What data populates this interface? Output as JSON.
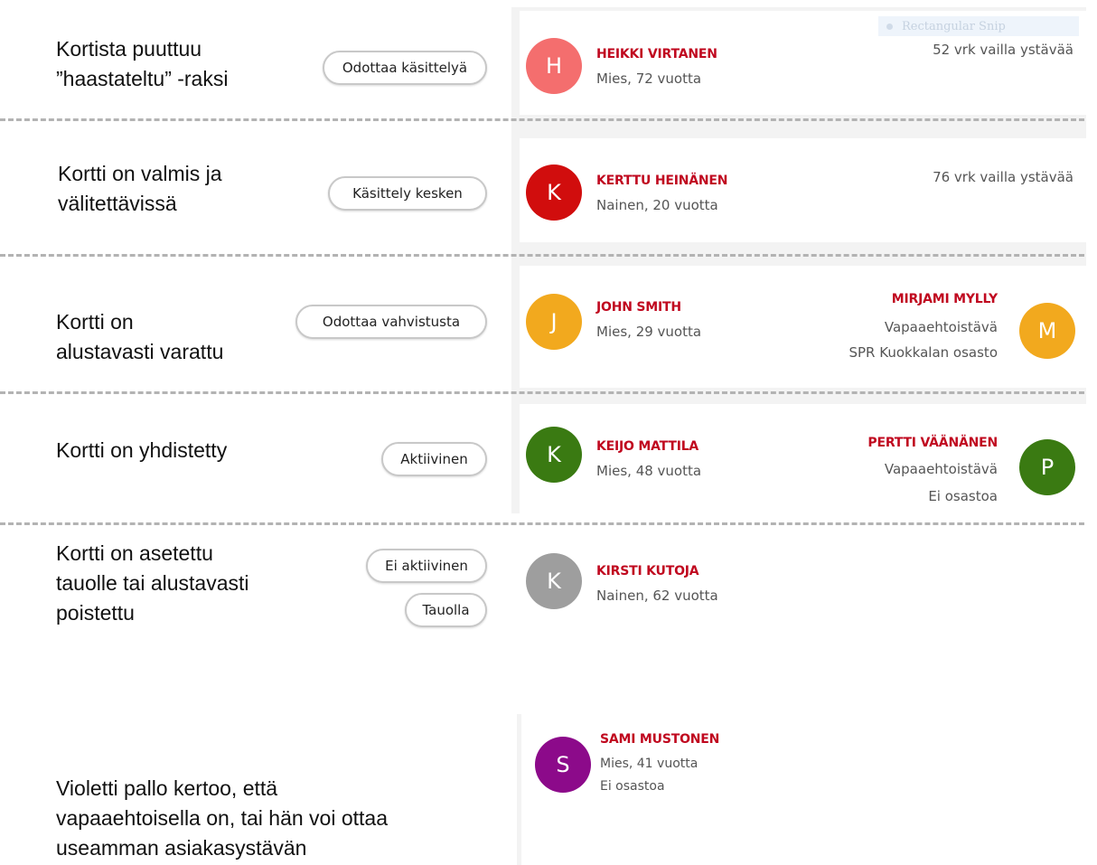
{
  "rows": [
    {
      "description": [
        "Kortista puuttuu",
        "”haastateltu” -raksi"
      ],
      "status": "Odottaa käsittelyä",
      "client": {
        "initial": "H",
        "name": "HEIKKI VIRTANEN",
        "details": "Mies, 72 vuotta",
        "color": "#f46e6e"
      },
      "waiting": "52 vrk vailla ystävää"
    },
    {
      "description": [
        "Kortti on valmis ja",
        "välitettävissä"
      ],
      "status": "Käsittely kesken",
      "client": {
        "initial": "K",
        "name": "KERTTU HEINÄNEN",
        "details": "Nainen, 20 vuotta",
        "color": "#d10d0d"
      },
      "waiting": "76 vrk vailla ystävää"
    },
    {
      "description": [
        "Kortti on",
        "alustavasti varattu"
      ],
      "status": "Odottaa vahvistusta",
      "client": {
        "initial": "J",
        "name": "JOHN SMITH",
        "details": "Mies, 29 vuotta",
        "color": "#f2a91e"
      },
      "volunteer": {
        "initial": "M",
        "name": "MIRJAMI MYLLY",
        "role": "Vapaaehtoistävä",
        "branch": "SPR Kuokkalan osasto",
        "color": "#f2a91e"
      }
    },
    {
      "description": [
        "Kortti on yhdistetty"
      ],
      "status": "Aktiivinen",
      "client": {
        "initial": "K",
        "name": "KEIJO MATTILA",
        "details": "Mies, 48 vuotta",
        "color": "#3a7a12"
      },
      "volunteer": {
        "initial": "P",
        "name": "PERTTI VÄÄNÄNEN",
        "role": "Vapaaehtoistävä",
        "branch": "Ei osastoa",
        "color": "#3a7a12"
      }
    },
    {
      "description": [
        "Kortti on asetettu",
        "tauolle tai alustavasti",
        "poistettu"
      ],
      "statuses": [
        "Ei aktiivinen",
        "Tauolla"
      ],
      "client": {
        "initial": "K",
        "name": "KIRSTI KUTOJA",
        "details": "Nainen, 62 vuotta",
        "color": "#9e9e9e"
      }
    }
  ],
  "bottom": {
    "description": [
      "Violetti pallo kertoo, että",
      "vapaaehtoisella on, tai hän voi ottaa",
      "useamman asiakasystävän"
    ],
    "person": {
      "initial": "S",
      "name": "SAMI MUSTONEN",
      "details": "Mies, 41 vuotta",
      "branch": "Ei osastoa",
      "color": "#8c0a8a"
    }
  },
  "overlay": {
    "snip_label": "Rectangular Snip"
  },
  "colors": {
    "name": "#c0081f",
    "panel": "#f3f3f3",
    "dash": "#b3b3b3"
  }
}
